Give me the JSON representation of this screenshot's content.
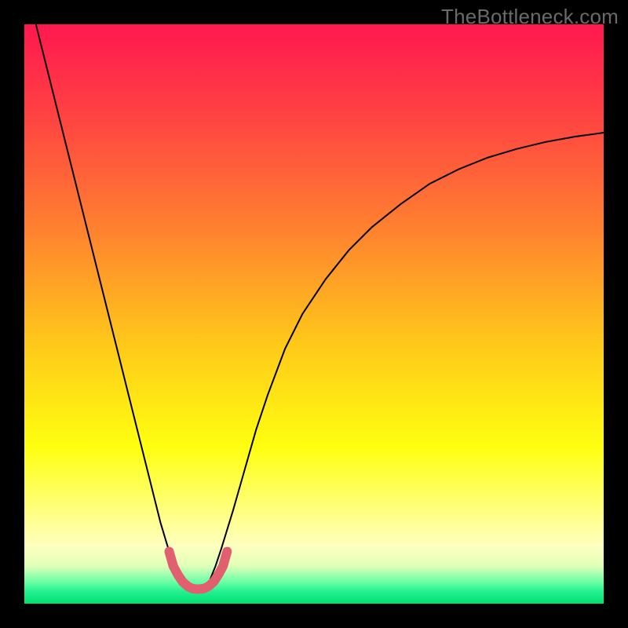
{
  "watermark": "TheBottleneck.com",
  "chart_data": {
    "type": "line",
    "title": "",
    "xlabel": "",
    "ylabel": "",
    "xlim": [
      0,
      100
    ],
    "ylim": [
      0,
      100
    ],
    "grid": false,
    "legend": false,
    "background_gradient": {
      "stops": [
        {
          "offset": 0.0,
          "color": "#ff1850"
        },
        {
          "offset": 0.15,
          "color": "#ff4043"
        },
        {
          "offset": 0.35,
          "color": "#ff8030"
        },
        {
          "offset": 0.55,
          "color": "#ffc81a"
        },
        {
          "offset": 0.73,
          "color": "#ffff10"
        },
        {
          "offset": 0.84,
          "color": "#ffff80"
        },
        {
          "offset": 0.9,
          "color": "#ffffc0"
        },
        {
          "offset": 0.935,
          "color": "#e0ffb8"
        },
        {
          "offset": 0.95,
          "color": "#a0ffb0"
        },
        {
          "offset": 0.965,
          "color": "#60ffa0"
        },
        {
          "offset": 0.98,
          "color": "#20f090"
        },
        {
          "offset": 1.0,
          "color": "#00e070"
        }
      ]
    },
    "series": [
      {
        "name": "bottleneck-curve",
        "stroke": "#000000",
        "stroke_width": 2,
        "x": [
          2,
          4,
          6,
          8,
          10,
          12,
          14,
          16,
          18,
          20,
          22,
          23.5,
          25,
          26,
          27,
          28,
          29,
          30,
          31,
          32,
          33,
          34,
          36,
          38,
          40,
          42,
          45,
          48,
          52,
          56,
          60,
          65,
          70,
          75,
          80,
          85,
          90,
          95,
          100
        ],
        "y": [
          100,
          92,
          84,
          76,
          68,
          60,
          52,
          44,
          36,
          28,
          20,
          14,
          9,
          6,
          4,
          2.5,
          2,
          2,
          2.5,
          4,
          6.5,
          9.5,
          16,
          23,
          30,
          36,
          44,
          50,
          56,
          61,
          65,
          69,
          72.5,
          75,
          77,
          78.5,
          79.7,
          80.6,
          81.3
        ]
      },
      {
        "name": "highlight-bottom",
        "stroke": "#e06070",
        "stroke_width": 12,
        "linecap": "round",
        "x": [
          25.0,
          25.7,
          26.5,
          27.3,
          28.2,
          29.0,
          30.0,
          31.0,
          31.8,
          32.7,
          33.5,
          34.3,
          35.0
        ],
        "y": [
          9.0,
          6.5,
          5.0,
          3.8,
          3.0,
          2.6,
          2.5,
          2.6,
          3.0,
          3.8,
          5.0,
          6.5,
          9.0
        ]
      }
    ]
  }
}
